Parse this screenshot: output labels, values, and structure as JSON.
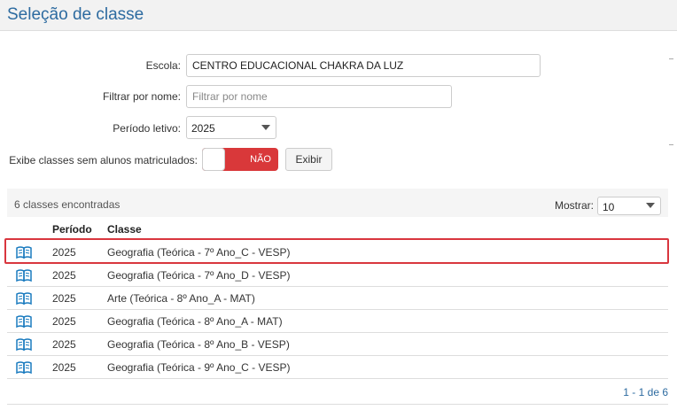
{
  "page": {
    "title": "Seleção de classe"
  },
  "form": {
    "escola_label": "Escola:",
    "escola_value": "CENTRO EDUCACIONAL CHAKRA DA LUZ",
    "filtro_label": "Filtrar por nome:",
    "filtro_placeholder": "Filtrar por nome",
    "periodo_label": "Período letivo:",
    "periodo_value": "2025",
    "exibe_label": "Exibe classes sem alunos matriculados:",
    "toggle_text": "NÃO",
    "exibir_button": "Exibir"
  },
  "results": {
    "count_text": "6 classes encontradas",
    "mostrar_label": "Mostrar:",
    "mostrar_value": "10",
    "columns": [
      "Período",
      "Classe"
    ],
    "rows": [
      {
        "periodo": "2025",
        "classe": "Geografia (Teórica - 7º Ano_C - VESP)"
      },
      {
        "periodo": "2025",
        "classe": "Geografia (Teórica - 7º Ano_D - VESP)"
      },
      {
        "periodo": "2025",
        "classe": "Arte (Teórica - 8º Ano_A - MAT)"
      },
      {
        "periodo": "2025",
        "classe": "Geografia (Teórica - 8º Ano_A - MAT)"
      },
      {
        "periodo": "2025",
        "classe": "Geografia (Teórica - 8º Ano_B - VESP)"
      },
      {
        "periodo": "2025",
        "classe": "Geografia (Teórica - 9º Ano_C - VESP)"
      }
    ],
    "pagination": "1 - 1 de 6"
  },
  "colors": {
    "accent": "#2d6ba0",
    "toggle_off": "#d9383a",
    "highlight": "#d9363e"
  },
  "icons": {
    "row_icon": "open-book-icon"
  }
}
